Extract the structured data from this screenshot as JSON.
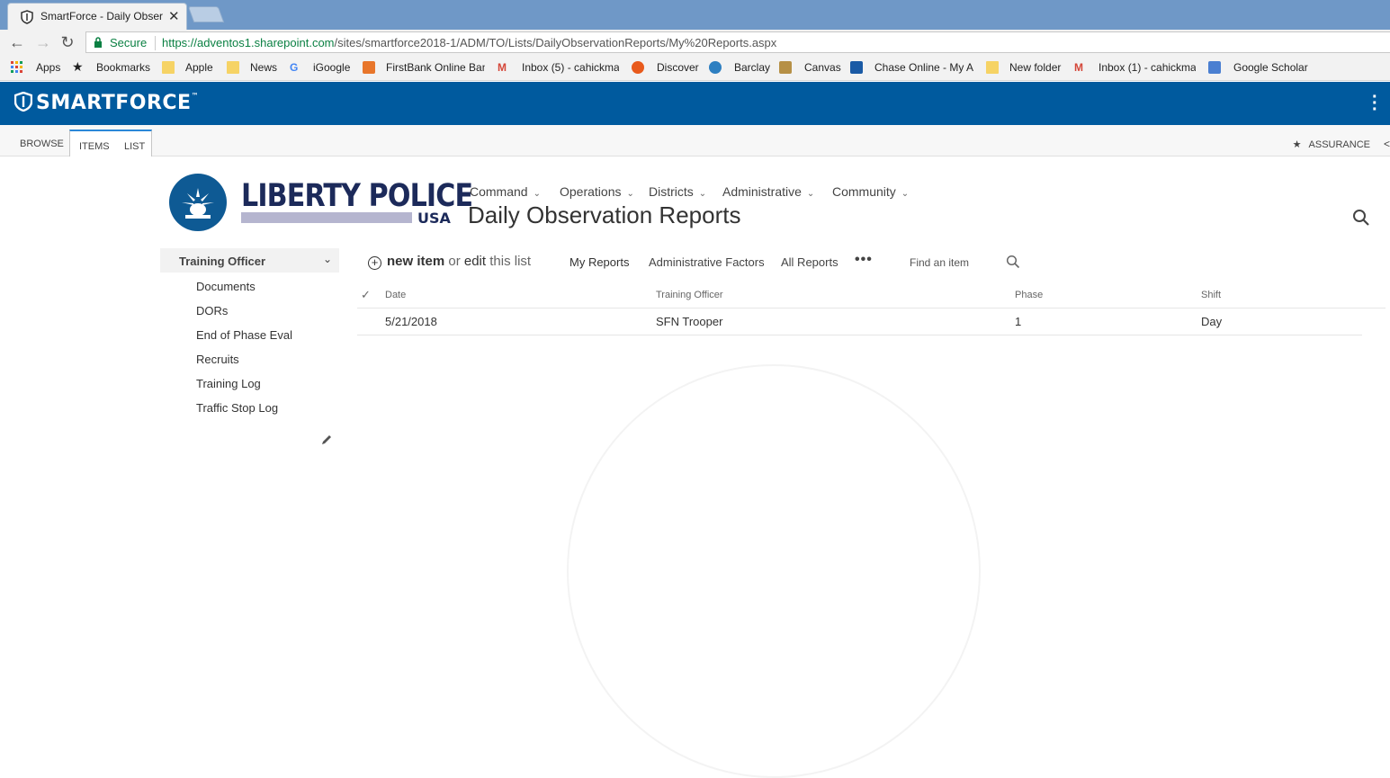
{
  "browser": {
    "tab_title": "SmartForce - Daily Obser",
    "close_glyph": "✕",
    "secure_label": "Secure",
    "url_host": "https://adventos1.sharepoint.com",
    "url_path": "/sites/smartforce2018-1/ADM/TO/Lists/DailyObservationReports/My%20Reports.aspx",
    "back_glyph": "←",
    "forward_glyph": "→",
    "reload_glyph": "↻"
  },
  "bookmarks": [
    {
      "label": "Apps",
      "icon": "apps-grid-icon"
    },
    {
      "label": "Bookmarks",
      "icon": "star-icon"
    },
    {
      "label": "Apple",
      "icon": "folder-icon"
    },
    {
      "label": "News",
      "icon": "folder-icon"
    },
    {
      "label": "iGoogle",
      "icon": "google-icon"
    },
    {
      "label": "FirstBank Online Ban",
      "icon": "bank-icon"
    },
    {
      "label": "Inbox (5) - cahickma",
      "icon": "gmail-icon"
    },
    {
      "label": "Discover",
      "icon": "discover-icon"
    },
    {
      "label": "Barclay",
      "icon": "barclay-icon"
    },
    {
      "label": "Canvas",
      "icon": "canvas-icon"
    },
    {
      "label": "Chase Online - My A",
      "icon": "chase-icon"
    },
    {
      "label": "New folder",
      "icon": "folder-icon"
    },
    {
      "label": "Inbox (1) - cahickma",
      "icon": "gmail-icon"
    },
    {
      "label": "Google Scholar",
      "icon": "scholar-icon"
    }
  ],
  "suitebar": {
    "brand": "SMARTFORCE",
    "tm": "™",
    "menu_icon": "more-vertical-icon"
  },
  "ribbon": {
    "tabs": [
      "BROWSE",
      "ITEMS",
      "LIST"
    ],
    "assurance": "ASSURANCE",
    "star": "★",
    "share": "<"
  },
  "logo": {
    "line1": "LIBERTY POLICE",
    "line2": "USA"
  },
  "topnav": [
    "Command",
    "Operations",
    "Districts",
    "Administrative",
    "Community"
  ],
  "page_title": "Daily Observation Reports",
  "leftnav": {
    "heading": "Training Officer",
    "links": [
      "Documents",
      "DORs",
      "End of Phase Eval",
      "Recruits",
      "Training Log",
      "Traffic Stop Log"
    ]
  },
  "commandbar": {
    "new_item": "new item",
    "or": "or",
    "edit": "edit",
    "this_list": "this list",
    "views": [
      "My Reports",
      "Administrative Factors",
      "All Reports"
    ],
    "more": "•••",
    "find_placeholder": "Find an item"
  },
  "table": {
    "check_glyph": "✓",
    "columns": [
      "Date",
      "Training Officer",
      "Phase",
      "Shift"
    ],
    "rows": [
      [
        "5/21/2018",
        "SFN Trooper",
        "1",
        "Day"
      ]
    ]
  },
  "colors": {
    "suitebar": "#005a9e",
    "tabstrip": "#6f98c7",
    "secure_green": "#0b8043",
    "logo_navy": "#1c2a5a"
  }
}
